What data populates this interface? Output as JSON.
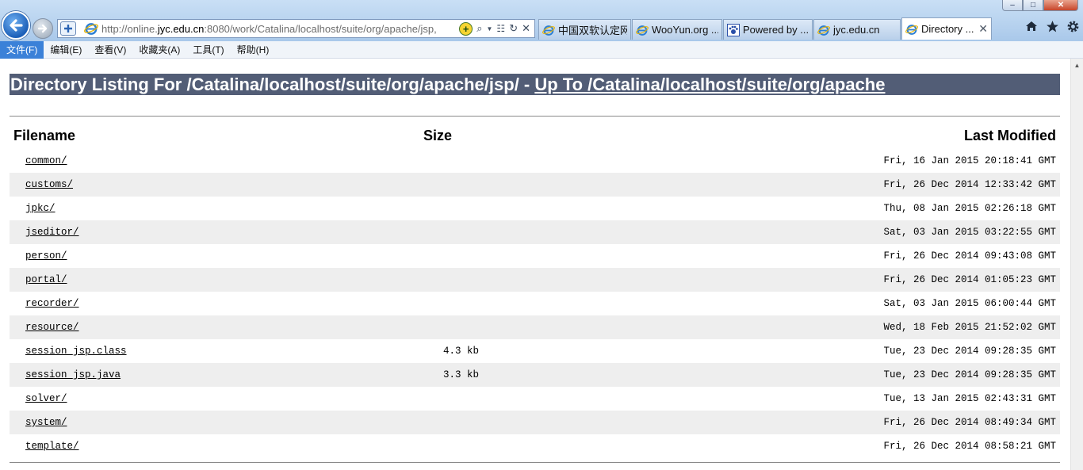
{
  "browser": {
    "address_url_prefix": "http://online.",
    "address_url_domain": "jyc.edu.cn",
    "address_url_rest": ":8080/work/Catalina/localhost/suite/org/apache/jsp,",
    "tabs": [
      {
        "label": "中国双软认定网",
        "icon": "ie-icon",
        "active": false
      },
      {
        "label": "WooYun.org ...",
        "icon": "ie-icon",
        "active": false
      },
      {
        "label": "Powered by ...",
        "icon": "paw-icon",
        "active": false
      },
      {
        "label": "jyc.edu.cn",
        "icon": "ie-icon",
        "active": false
      },
      {
        "label": "Directory ...",
        "icon": "ie-icon",
        "active": true
      }
    ],
    "icons": {
      "home": "home-icon",
      "favorites": "star-icon",
      "tools": "gear-icon"
    }
  },
  "menubar": {
    "items": [
      "文件(F)",
      "编辑(E)",
      "查看(V)",
      "收藏夹(A)",
      "工具(T)",
      "帮助(H)"
    ]
  },
  "page": {
    "heading_prefix": "Directory Listing For /Catalina/localhost/suite/org/apache/jsp/ - ",
    "heading_link": "Up To /Catalina/localhost/suite/org/apache",
    "columns": {
      "filename": "Filename",
      "size": "Size",
      "modified": "Last Modified"
    },
    "rows": [
      {
        "name": "common/",
        "size": "",
        "modified": "Fri, 16 Jan 2015 20:18:41 GMT"
      },
      {
        "name": "customs/",
        "size": "",
        "modified": "Fri, 26 Dec 2014 12:33:42 GMT"
      },
      {
        "name": "jpkc/",
        "size": "",
        "modified": "Thu, 08 Jan 2015 02:26:18 GMT"
      },
      {
        "name": "jseditor/",
        "size": "",
        "modified": "Sat, 03 Jan 2015 03:22:55 GMT"
      },
      {
        "name": "person/",
        "size": "",
        "modified": "Fri, 26 Dec 2014 09:43:08 GMT"
      },
      {
        "name": "portal/",
        "size": "",
        "modified": "Fri, 26 Dec 2014 01:05:23 GMT"
      },
      {
        "name": "recorder/",
        "size": "",
        "modified": "Sat, 03 Jan 2015 06:00:44 GMT"
      },
      {
        "name": "resource/",
        "size": "",
        "modified": "Wed, 18 Feb 2015 21:52:02 GMT"
      },
      {
        "name": "session_jsp.class",
        "size": "4.3 kb",
        "modified": "Tue, 23 Dec 2014 09:28:35 GMT"
      },
      {
        "name": "session_jsp.java",
        "size": "3.3 kb",
        "modified": "Tue, 23 Dec 2014 09:28:35 GMT"
      },
      {
        "name": "solver/",
        "size": "",
        "modified": "Tue, 13 Jan 2015 02:43:31 GMT"
      },
      {
        "name": "system/",
        "size": "",
        "modified": "Fri, 26 Dec 2014 08:49:34 GMT"
      },
      {
        "name": "template/",
        "size": "",
        "modified": "Fri, 26 Dec 2014 08:58:21 GMT"
      }
    ]
  },
  "colors": {
    "heading_bg": "#525d76",
    "row_shade": "#eeeeee",
    "menu_active": "#3b81d8"
  }
}
